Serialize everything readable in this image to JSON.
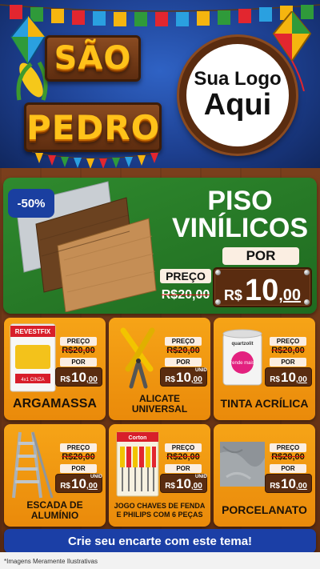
{
  "header": {
    "brand_line1": "SÃO",
    "brand_line2": "PEDRO",
    "logo_line1": "Sua Logo",
    "logo_line2": "Aqui"
  },
  "hero": {
    "discount": "-50%",
    "title_line1": "PISO",
    "title_line2": "VINÍLICOS",
    "por_label": "POR",
    "preco_label": "PREÇO",
    "old_price": "R$20,00",
    "currency": "R$",
    "price_int": "10",
    "price_dec": ",00"
  },
  "products": [
    {
      "name_line1": "ARGAMASSA",
      "name_line2": "",
      "preco_label": "PREÇO",
      "old_price": "R$20,00",
      "por_label": "POR",
      "currency": "R$",
      "price_int": "10",
      "price_dec": ",00",
      "unit": "",
      "image_text": "REVESTFIX",
      "image_subtext": "4x1 CINZA"
    },
    {
      "name_line1": "ALICATE",
      "name_line2": "UNIVERSAL",
      "preco_label": "PREÇO",
      "old_price": "R$20,00",
      "por_label": "POR",
      "currency": "R$",
      "price_int": "10",
      "price_dec": ",00",
      "unit": "UNID",
      "image_text": "",
      "image_subtext": ""
    },
    {
      "name_line1": "TINTA ACRÍLICA",
      "name_line2": "",
      "preco_label": "PREÇO",
      "old_price": "R$20,00",
      "por_label": "POR",
      "currency": "R$",
      "price_int": "10",
      "price_dec": ",00",
      "unit": "",
      "image_text": "quartzolit",
      "image_subtext": "rende mais"
    },
    {
      "name_line1": "ESCADA DE",
      "name_line2": "ALUMÍNIO",
      "preco_label": "PREÇO",
      "old_price": "R$20,00",
      "por_label": "POR",
      "currency": "R$",
      "price_int": "10",
      "price_dec": ",00",
      "unit": "UNID",
      "image_text": "",
      "image_subtext": ""
    },
    {
      "name_line1": "JOGO CHAVES DE FENDA",
      "name_line2": "E PHILIPS COM 6 PEÇAS",
      "preco_label": "PREÇO",
      "old_price": "R$20,00",
      "por_label": "POR",
      "currency": "R$",
      "price_int": "10",
      "price_dec": ",00",
      "unit": "UNID",
      "image_text": "Corton",
      "image_subtext": ""
    },
    {
      "name_line1": "PORCELANATO",
      "name_line2": "",
      "preco_label": "PREÇO",
      "old_price": "R$20,00",
      "por_label": "POR",
      "currency": "R$",
      "price_int": "10",
      "price_dec": ",00",
      "unit": "",
      "image_text": "",
      "image_subtext": ""
    }
  ],
  "cta": {
    "label": "Crie seu encarte com este tema!"
  },
  "footer": {
    "disclaimer": "*Imagens Meramente Ilustrativas"
  },
  "colors": {
    "sky_blue": "#1d3f8f",
    "wood_brown": "#6b3518",
    "hero_green": "#2f8a2e",
    "card_orange": "#f6a417",
    "price_box": "#5a2c10",
    "brand_yellow": "#ffc21a",
    "cta_blue": "#1b3fa6",
    "strike_red": "#d01010"
  }
}
